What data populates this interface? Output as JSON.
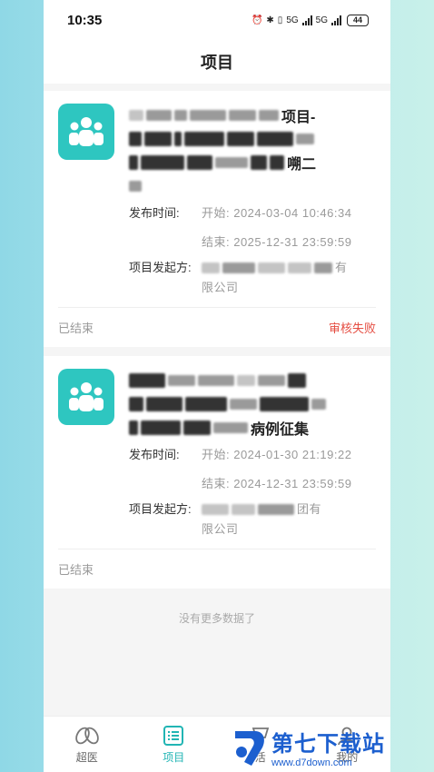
{
  "status_bar": {
    "time": "10:35",
    "network1": "5G",
    "network2": "5G",
    "battery": "44"
  },
  "header": {
    "title": "项目"
  },
  "projects": [
    {
      "title_fragments": [
        "项目-",
        "嗍二"
      ],
      "publish_label": "发布时间:",
      "start": "开始: 2024-03-04 10:46:34",
      "end": "结束: 2025-12-31 23:59:59",
      "initiator_label": "项目发起方:",
      "initiator_fragment": "有",
      "initiator_tail": "限公司",
      "status": "已结束",
      "review_status": "审核失败"
    },
    {
      "title_fragments": [
        "病例征集"
      ],
      "publish_label": "发布时间:",
      "start": "开始: 2024-01-30 21:19:22",
      "end": "结束: 2024-12-31 23:59:59",
      "initiator_label": "项目发起方:",
      "initiator_fragment": "团有",
      "initiator_tail": "限公司",
      "status": "已结束",
      "review_status": ""
    }
  ],
  "more_hint": "没有更多数据了",
  "tabs": [
    {
      "label": "超医",
      "icon": "hands-icon"
    },
    {
      "label": "项目",
      "icon": "list-icon",
      "active": true
    },
    {
      "label": "活",
      "icon": "activity-icon"
    },
    {
      "label": "我的",
      "icon": "user-icon"
    }
  ],
  "watermark": {
    "main": "第七下载站",
    "sub": "www.d7down.com"
  },
  "colors": {
    "accent": "#21b5b4",
    "icon_bg": "#2ec6c0",
    "fail": "#e54d42",
    "watermark": "#1c5fcf"
  }
}
